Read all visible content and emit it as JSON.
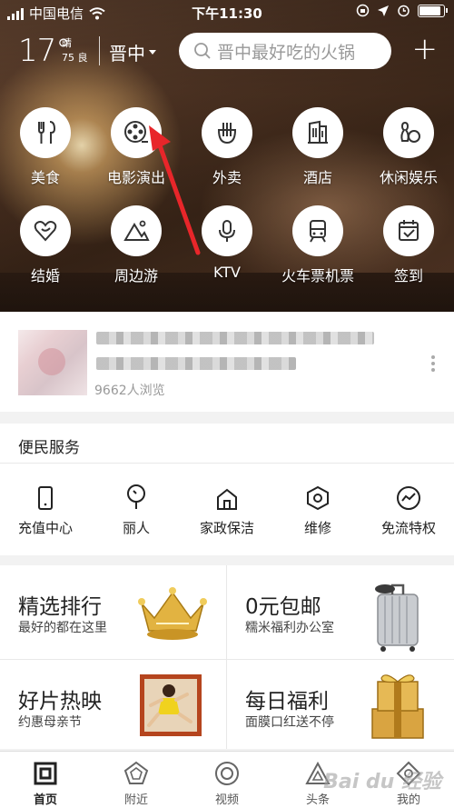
{
  "status_bar": {
    "carrier": "中国电信",
    "time": "下午11:30",
    "battery_level": 0.9
  },
  "header": {
    "temperature": "17°",
    "weather": "晴",
    "aqi_value": "75",
    "aqi_label": "良",
    "city": "晋中",
    "search_placeholder": "晋中最好吃的火锅",
    "plus_label": "+"
  },
  "categories": [
    {
      "label": "美食",
      "icon": "fork-knife-icon"
    },
    {
      "label": "电影演出",
      "icon": "film-reel-icon"
    },
    {
      "label": "外卖",
      "icon": "takeout-icon"
    },
    {
      "label": "酒店",
      "icon": "hotel-icon"
    },
    {
      "label": "休闲娱乐",
      "icon": "bowling-icon"
    },
    {
      "label": "结婚",
      "icon": "heart-icon"
    },
    {
      "label": "周边游",
      "icon": "mountain-icon"
    },
    {
      "label": "KTV",
      "icon": "microphone-icon"
    },
    {
      "label": "火车票机票",
      "icon": "train-icon"
    },
    {
      "label": "签到",
      "icon": "calendar-check-icon"
    }
  ],
  "news": {
    "views": "9662人浏览"
  },
  "services": {
    "title": "便民服务",
    "items": [
      {
        "label": "充值中心",
        "icon": "phone-icon"
      },
      {
        "label": "丽人",
        "icon": "mirror-icon"
      },
      {
        "label": "家政保洁",
        "icon": "house-icon"
      },
      {
        "label": "维修",
        "icon": "hex-nut-icon"
      },
      {
        "label": "免流特权",
        "icon": "trend-icon"
      }
    ]
  },
  "promos": [
    {
      "title": "精选排行",
      "subtitle": "最好的都在这里",
      "icon": "crown-icon"
    },
    {
      "title": "0元包邮",
      "subtitle": "糯米福利办公室",
      "icon": "suitcase-icon"
    },
    {
      "title": "好片热映",
      "subtitle": "约惠母亲节",
      "icon": "movie-poster-icon"
    },
    {
      "title": "每日福利",
      "subtitle": "面膜口红送不停",
      "icon": "gift-box-icon"
    }
  ],
  "tabbar": [
    {
      "label": "首页",
      "icon": "home-square-icon",
      "active": true
    },
    {
      "label": "附近",
      "icon": "pentagon-icon",
      "active": false
    },
    {
      "label": "视频",
      "icon": "video-circle-icon",
      "active": false
    },
    {
      "label": "头条",
      "icon": "triangle-icon",
      "active": false
    },
    {
      "label": "我的",
      "icon": "profile-icon",
      "active": false
    }
  ],
  "watermark": "Bai du 经验",
  "colors": {
    "accent_red": "#e8262a",
    "text_dark": "#222222"
  }
}
